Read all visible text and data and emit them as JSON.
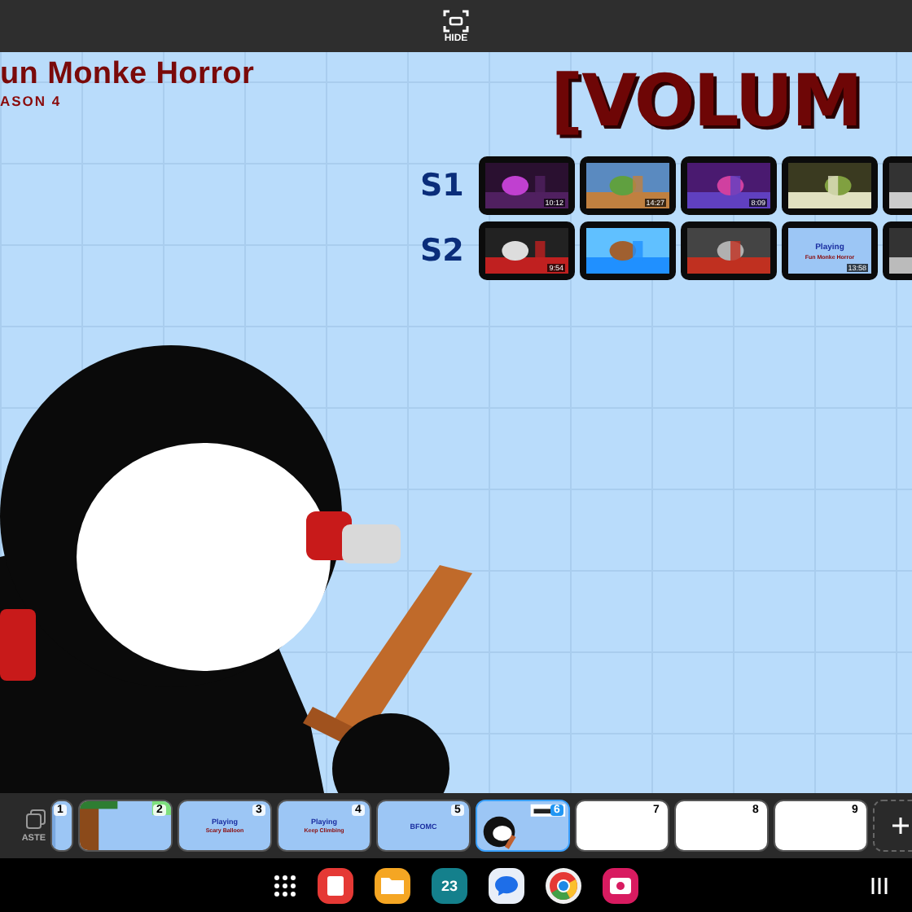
{
  "top_bar": {
    "hide_label": "HIDE"
  },
  "canvas": {
    "title": "un Monke Horror",
    "subtitle": "ASON 4",
    "heading": "[VOLUM",
    "rows": [
      {
        "label": "S1",
        "videos": [
          {
            "kind": "video",
            "duration": "10:12"
          },
          {
            "kind": "video",
            "duration": "14:27"
          },
          {
            "kind": "video",
            "duration": "8:09"
          },
          {
            "kind": "video"
          },
          {
            "kind": "video"
          }
        ]
      },
      {
        "label": "S2",
        "videos": [
          {
            "kind": "video",
            "duration": "9:54"
          },
          {
            "kind": "video"
          },
          {
            "kind": "video"
          },
          {
            "kind": "title_card",
            "lines": [
              "Playing",
              "Fun Monke Horror"
            ],
            "duration": "13:58"
          },
          {
            "kind": "video"
          }
        ]
      }
    ]
  },
  "page_strip": {
    "paste_label": "ASTE",
    "pages": [
      {
        "number": "1",
        "kind": "picture",
        "selected": false
      },
      {
        "number": "2",
        "kind": "picture",
        "selected": false
      },
      {
        "number": "3",
        "kind": "title_card",
        "lines": [
          "Playing",
          "Scary Balloon"
        ],
        "selected": false
      },
      {
        "number": "4",
        "kind": "title_card",
        "lines": [
          "Playing",
          "Keep Climbing"
        ],
        "selected": false
      },
      {
        "number": "5",
        "kind": "title_card",
        "lines": [
          "BFOMC"
        ],
        "selected": false
      },
      {
        "number": "6",
        "kind": "picture",
        "selected": true
      },
      {
        "number": "7",
        "kind": "blank",
        "selected": false
      },
      {
        "number": "8",
        "kind": "blank",
        "selected": false
      },
      {
        "number": "9",
        "kind": "blank",
        "selected": false
      }
    ]
  },
  "nav_bar": {
    "calendar_day": "23"
  }
}
